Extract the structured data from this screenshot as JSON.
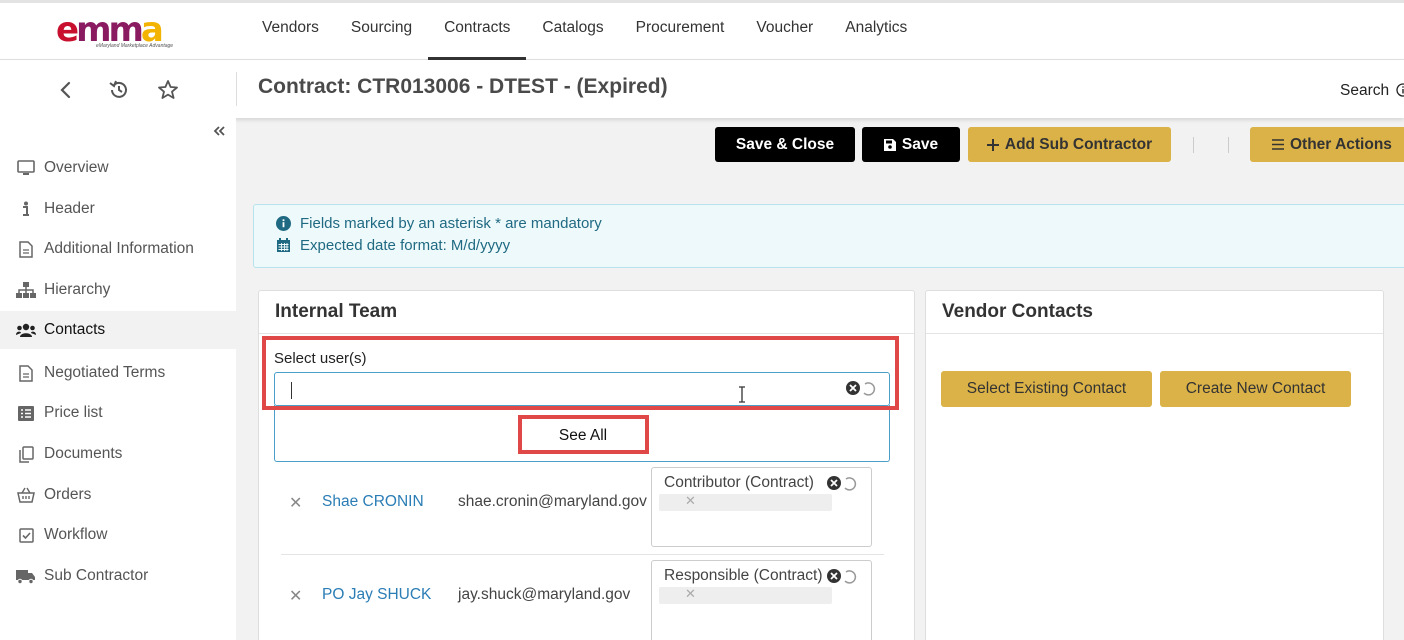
{
  "brand": {
    "logo_text_e": "e",
    "logo_text_mm": "mm",
    "logo_text_a": "a",
    "tagline": "eMaryland Marketplace Advantage"
  },
  "nav": [
    "Vendors",
    "Sourcing",
    "Contracts",
    "Catalogs",
    "Procurement",
    "Voucher",
    "Analytics"
  ],
  "nav_active": "Contracts",
  "page_title": "Contract: CTR013006 - DTEST - (Expired)",
  "search_label": "Search",
  "sidebar": [
    {
      "label": "Overview",
      "icon": "monitor-icon"
    },
    {
      "label": "Header",
      "icon": "info-icon"
    },
    {
      "label": "Additional Information",
      "icon": "document-icon"
    },
    {
      "label": "Hierarchy",
      "icon": "sitemap-icon"
    },
    {
      "label": "Contacts",
      "icon": "users-icon"
    },
    {
      "label": "Negotiated Terms",
      "icon": "document-icon"
    },
    {
      "label": "Price list",
      "icon": "list-icon"
    },
    {
      "label": "Documents",
      "icon": "copy-icon"
    },
    {
      "label": "Orders",
      "icon": "basket-icon"
    },
    {
      "label": "Workflow",
      "icon": "check-square-icon"
    },
    {
      "label": "Sub Contractor",
      "icon": "truck-icon"
    }
  ],
  "sidebar_active": "Contacts",
  "actions": {
    "save_close": "Save & Close",
    "save": "Save",
    "add_sub": "Add Sub Contractor",
    "other": "Other Actions"
  },
  "info": {
    "line1": "Fields marked by an asterisk * are mandatory",
    "line2": "Expected date format: M/d/yyyy"
  },
  "internal_team": {
    "title": "Internal Team",
    "select_label": "Select user(s)",
    "input_value": "",
    "see_all": "See All",
    "members": [
      {
        "name": "Shae CRONIN",
        "email": "shae.cronin@maryland.gov",
        "role": "Contributor (Contract)"
      },
      {
        "name": "PO Jay SHUCK",
        "email": "jay.shuck@maryland.gov",
        "role": "Responsible (Contract)"
      }
    ]
  },
  "vendor_contacts": {
    "title": "Vendor Contacts",
    "select_existing": "Select Existing Contact",
    "create_new": "Create New Contact"
  },
  "colors": {
    "accent_gold": "#dbb247",
    "link_blue": "#2a7db5",
    "highlight_red": "#e04848",
    "info_text": "#1f6a82"
  }
}
